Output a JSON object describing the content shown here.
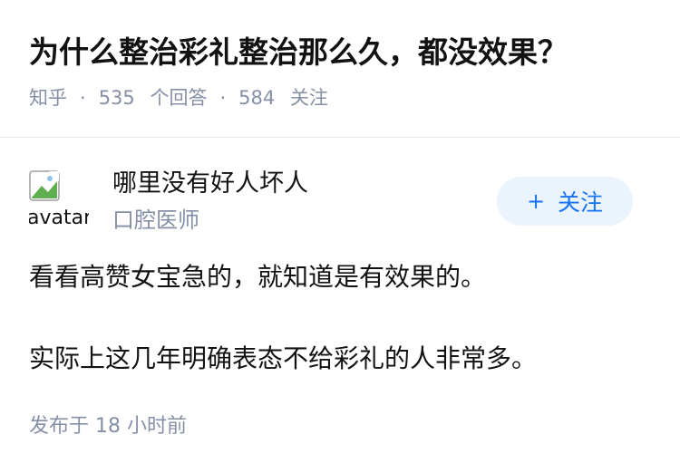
{
  "question": {
    "title": "为什么整治彩礼整治那么久，都没效果？",
    "source": "知乎",
    "separator": "·",
    "answers_count": "535",
    "answers_label": "个回答",
    "followers_count": "584",
    "followers_label": "关注"
  },
  "author": {
    "avatar_alt": "avatar",
    "name": "哪里没有好人坏人",
    "bio": "口腔医师",
    "follow_label": "关注",
    "follow_icon": "plus-icon"
  },
  "answer": {
    "paragraphs": [
      "看看高赞女宝急的，就知道是有效果的。",
      "实际上这几年明确表态不给彩礼的人非常多。"
    ],
    "published": "发布于 18 小时前"
  },
  "colors": {
    "text": "#121212",
    "muted": "#8590a6",
    "accent": "#1772f6",
    "accent_bg": "#ebf4fc",
    "divider": "#ebebeb"
  }
}
